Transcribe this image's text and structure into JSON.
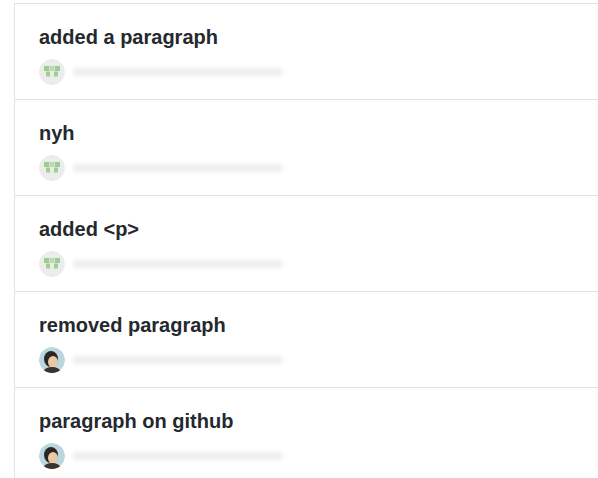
{
  "commits": [
    {
      "message": "added a paragraph",
      "kind": "identicon"
    },
    {
      "message": "nyh",
      "kind": "identicon"
    },
    {
      "message": "added <p>",
      "kind": "identicon"
    },
    {
      "message": "removed paragraph",
      "kind": "photo"
    },
    {
      "message": "paragraph on github",
      "kind": "photo"
    }
  ]
}
